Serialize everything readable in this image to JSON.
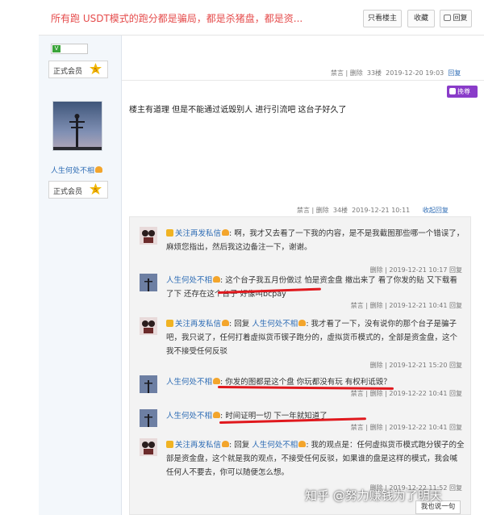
{
  "header": {
    "title": "所有跑 USDT模式的跑分都是骗局，都是杀猪盘，都是资...",
    "buttons": {
      "only_op": "只看楼主",
      "favorite": "收藏",
      "reply": "回复"
    }
  },
  "floor33": {
    "rank": "正式会员",
    "medal": "5",
    "vip_icon": "vip-icon",
    "meta": {
      "report": "禁言",
      "delete": "删除",
      "floor": "33楼",
      "time": "2019-12-20 19:03",
      "reply": "回复"
    }
  },
  "floor34": {
    "username": "人生何处不相",
    "rank": "正式会员",
    "medal": "5",
    "reward": "挽尊",
    "content": "楼主有道理 但是不能通过诋毁别人 进行引流吧 这台子好久了",
    "meta": {
      "report": "禁言",
      "delete": "删除",
      "floor": "34楼",
      "time": "2019-12-21 10:11",
      "collapse": "收起回复"
    }
  },
  "comments": [
    {
      "user": "关注再发私信",
      "reply_to": "",
      "text": "啊，我才又去看了一下我的内容，是不是我截图那些哪一个错误了，麻烦您指出，然后我这边备注一下，谢谢。",
      "delete": "删除",
      "time": "2019-12-21 10:17",
      "reply": "回复"
    },
    {
      "user": "人生何处不相",
      "reply_to": "",
      "text": "这个台子我五月份做过 怕是资金盘 撤出来了 看了你发的贴 又下载看了下 还存在这个台子 好像叫bcpay",
      "report": "禁言",
      "delete": "删除",
      "time": "2019-12-21 10:41",
      "reply": "回复"
    },
    {
      "user": "关注再发私信",
      "reply_prefix": "回复",
      "reply_to": "人生何处不相",
      "text": "我才看了一下，没有说你的那个台子是骗子吧，我只说了，任何打着虚拟货币锲子跑分的，虚拟货币模式的，全部是资金盘，这个我不接受任何反驳",
      "delete": "删除",
      "time": "2019-12-21 15:20",
      "reply": "回复"
    },
    {
      "user": "人生何处不相",
      "reply_to": "",
      "text": "你发的图都是这个盘 你玩都没有玩 有权利诋毁？",
      "report": "禁言",
      "delete": "删除",
      "time": "2019-12-22 10:41",
      "reply": "回复"
    },
    {
      "user": "人生何处不相",
      "reply_to": "",
      "text": "时间证明一切 下一年就知道了",
      "report": "禁言",
      "delete": "删除",
      "time": "2019-12-22 10:41",
      "reply": "回复"
    },
    {
      "user": "关注再发私信",
      "reply_prefix": "回复",
      "reply_to": "人生何处不相",
      "text": "我的观点是：任何虚拟货币模式跑分锲子的全部是资金盘，这个就是我的观点，不接受任何反驳，如果谁的盘是这样的模式，我会喊任何人不要去，你可以随便怎么想。",
      "delete": "删除",
      "time": "2019-12-22 11:52",
      "reply": "回复"
    }
  ],
  "say_button": "我也说一句",
  "watermark": "知乎 @努力赚钱为了明天",
  "colors": {
    "title": "#e54b4b",
    "link": "#2f6db5",
    "reward": "#8a3cc9",
    "annotation": "#e0181d"
  }
}
